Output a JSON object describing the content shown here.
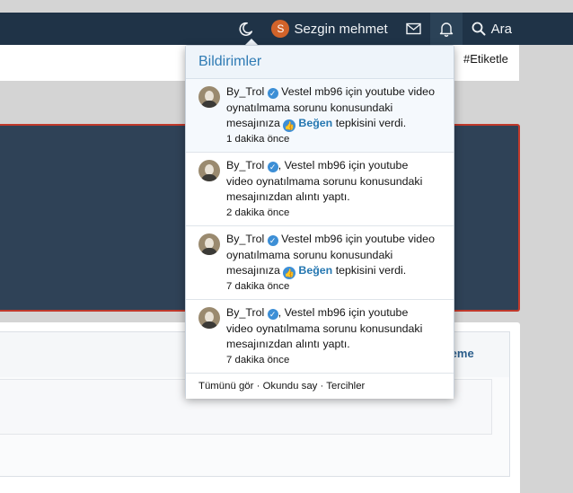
{
  "navbar": {
    "theme_icon": "moon-icon",
    "user_initial": "S",
    "user_name": "Sezgin mehmet",
    "user_avatar_color": "#d1632a",
    "inbox_icon": "envelope-icon",
    "alerts_icon": "bell-icon",
    "search_label": "Ara",
    "search_icon": "search-icon"
  },
  "page": {
    "tag_label": "#Etiketle",
    "preview_label": "nizleme"
  },
  "notifications": {
    "title": "Bildirimler",
    "items": [
      {
        "user": "By_Trol",
        "line1": "Vestel mb96 için youtube video",
        "line2": "oynatılmama sorunu konusundaki",
        "line3_prefix": "mesajınıza",
        "reaction": "Beğen",
        "line3_suffix": "tepkisini verdi.",
        "time": "1 dakika önce"
      },
      {
        "user": "By_Trol",
        "line1": ", Vestel mb96 için youtube",
        "line2": "video oynatılmama sorunu konusundaki",
        "line3": "mesajınızdan alıntı yaptı.",
        "time": "2 dakika önce"
      },
      {
        "user": "By_Trol",
        "line1": "Vestel mb96 için youtube video",
        "line2": "oynatılmama sorunu konusundaki",
        "line3_prefix": "mesajınıza",
        "reaction": "Beğen",
        "line3_suffix": "tepkisini verdi.",
        "time": "7 dakika önce"
      },
      {
        "user": "By_Trol",
        "line1": ", Vestel mb96 için youtube",
        "line2": "video oynatılmama sorunu konusundaki",
        "line3": "mesajınızdan alıntı yaptı.",
        "time": "7 dakika önce"
      }
    ],
    "footer": {
      "see_all": "Tümünü gör",
      "mark_read": "Okundu say",
      "preferences": "Tercihler",
      "separator": "·"
    }
  },
  "colors": {
    "navbar_bg": "#1f3347",
    "accent": "#2f7bb4",
    "reaction_blue": "#3d8fd6",
    "panel_dark": "#2f4257",
    "panel_border": "#c0392b"
  }
}
